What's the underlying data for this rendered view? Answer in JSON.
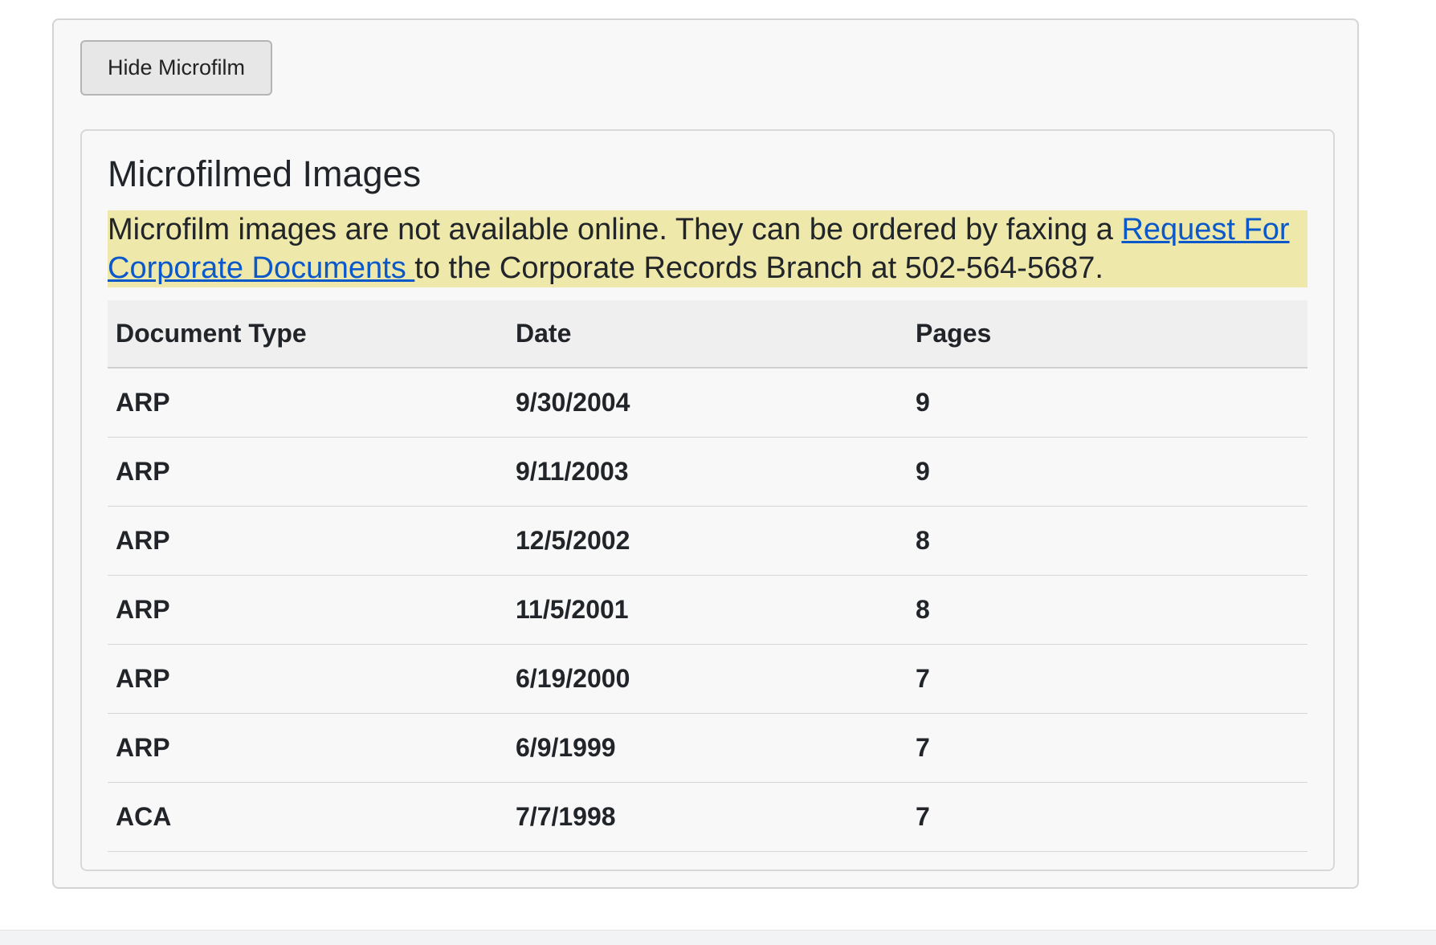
{
  "toggle_button": {
    "label": "Hide Microfilm"
  },
  "card": {
    "title": "Microfilmed Images",
    "notice": {
      "text_before": "Microfilm images are not available online. They can be ordered by faxing a ",
      "link_text": "Request For Corporate Documents ",
      "text_after": "to the Corporate Records Branch at 502-564-5687."
    }
  },
  "table": {
    "headers": [
      "Document Type",
      "Date",
      "Pages"
    ],
    "rows": [
      [
        "ARP",
        "9/30/2004",
        "9"
      ],
      [
        "ARP",
        "9/11/2003",
        "9"
      ],
      [
        "ARP",
        "12/5/2002",
        "8"
      ],
      [
        "ARP",
        "11/5/2001",
        "8"
      ],
      [
        "ARP",
        "6/19/2000",
        "7"
      ],
      [
        "ARP",
        "6/9/1999",
        "7"
      ],
      [
        "ACA",
        "7/7/1998",
        "7"
      ]
    ]
  },
  "colors": {
    "notice_highlight": "#eee8aa",
    "link": "#0a58ca"
  }
}
